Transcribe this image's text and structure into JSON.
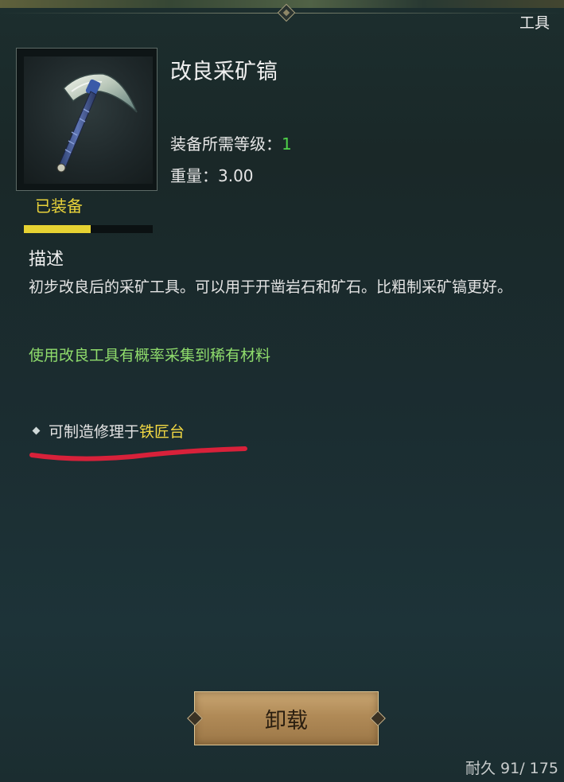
{
  "header": {
    "category": "工具"
  },
  "item": {
    "name": "改良采矿镐",
    "icon": "pickaxe-icon",
    "equipped_label": "已装备",
    "durability_fraction": 0.52
  },
  "stats": {
    "level_label": "装备所需等级：",
    "level_value": "1",
    "weight_label": "重量：",
    "weight_value": "3.00"
  },
  "description": {
    "title": "描述",
    "text": "初步改良后的采矿工具。可以用于开凿岩石和矿石。比粗制采矿镐更好。",
    "bonus": "使用改良工具有概率采集到稀有材料"
  },
  "crafting": {
    "prefix": "可制造修理于",
    "location": "铁匠台"
  },
  "actions": {
    "unequip_label": "卸载"
  },
  "footer": {
    "durability_text": "耐久 91/ 175"
  },
  "colors": {
    "equipped": "#e9d33a",
    "level_value": "#4fd24a",
    "bonus": "#8fdc6c",
    "location": "#f2d843",
    "annotation": "#d8213a",
    "button": "#b08a57"
  }
}
